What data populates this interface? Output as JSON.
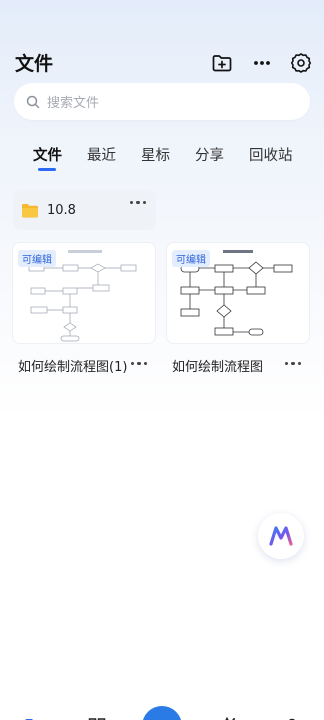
{
  "header": {
    "title": "文件",
    "icons": [
      "new-folder-icon",
      "more-icon",
      "settings-icon"
    ]
  },
  "search": {
    "placeholder": "搜索文件"
  },
  "tabs": [
    {
      "label": "文件",
      "active": true
    },
    {
      "label": "最近",
      "active": false
    },
    {
      "label": "星标",
      "active": false
    },
    {
      "label": "分享",
      "active": false
    },
    {
      "label": "回收站",
      "active": false
    }
  ],
  "folder": {
    "name": "10.8"
  },
  "files": [
    {
      "name": "如何绘制流程图(1)",
      "badge": "可编辑"
    },
    {
      "name": "如何绘制流程图",
      "badge": "可编辑"
    }
  ],
  "colors": {
    "accent": "#2b6bf3",
    "folder_yellow": "#f5b82e",
    "badge_bg": "#e4edfd",
    "badge_text": "#2e64d9"
  },
  "bottom_nav": {
    "icons": [
      "files-icon",
      "apps-icon",
      "create-icon",
      "ai-icon",
      "profile-icon"
    ]
  }
}
